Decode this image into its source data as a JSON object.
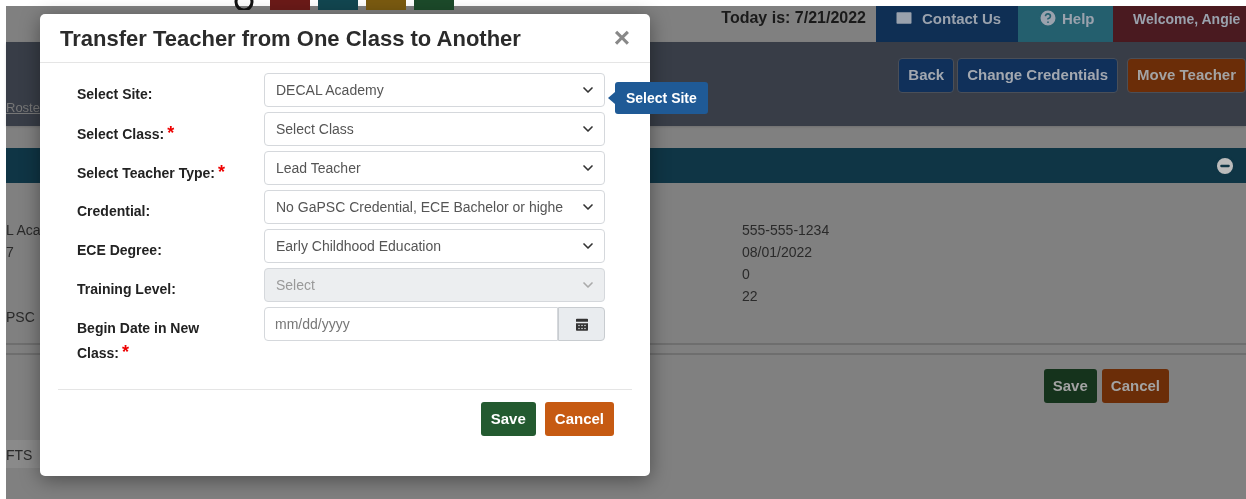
{
  "page": {
    "header": {
      "today": "Today is: 7/21/2022",
      "contact_us": "Contact Us",
      "help": "Help",
      "welcome": "Welcome, Angie"
    },
    "nav": {
      "link": "Roste",
      "buttons": [
        {
          "label": "Back",
          "kind": "primary"
        },
        {
          "label": "Change Credentials",
          "kind": "primary"
        },
        {
          "label": "Move Teacher",
          "kind": "warning"
        }
      ]
    },
    "details": {
      "left_texts": [
        "L Aca",
        "7",
        "PSC"
      ],
      "values": [
        "555-555-1234",
        "08/01/2022",
        "0",
        "22"
      ]
    },
    "buttons": [
      {
        "label": "Save",
        "kind": "success"
      },
      {
        "label": "Cancel",
        "kind": "warning"
      }
    ],
    "bottom_tab": "FTS"
  },
  "dialog": {
    "title": "Transfer Teacher from One Class to Another",
    "close": "×",
    "tooltip": "Select Site",
    "required_mark": "*",
    "fields": [
      {
        "kind": "select",
        "label": "Select Site:",
        "required": false,
        "value": "DECAL Academy",
        "disabled": false
      },
      {
        "kind": "select",
        "label": "Select Class:",
        "required": true,
        "value": "Select Class",
        "disabled": false
      },
      {
        "kind": "select",
        "label": "Select Teacher Type:",
        "required": true,
        "value": "Lead Teacher",
        "disabled": false
      },
      {
        "kind": "select",
        "label": "Credential:",
        "required": false,
        "value": "No GaPSC Credential, ECE Bachelor or highe",
        "disabled": false
      },
      {
        "kind": "select",
        "label": "ECE Degree:",
        "required": false,
        "value": "Early Childhood Education",
        "disabled": false
      },
      {
        "kind": "select",
        "label": "Training Level:",
        "required": false,
        "value": "Select",
        "disabled": true
      },
      {
        "kind": "date",
        "label": "Begin Date in New Class:",
        "required": true,
        "placeholder": "mm/dd/yyyy"
      }
    ],
    "buttons": [
      {
        "label": "Save",
        "kind": "success"
      },
      {
        "label": "Cancel",
        "kind": "warning"
      }
    ]
  }
}
